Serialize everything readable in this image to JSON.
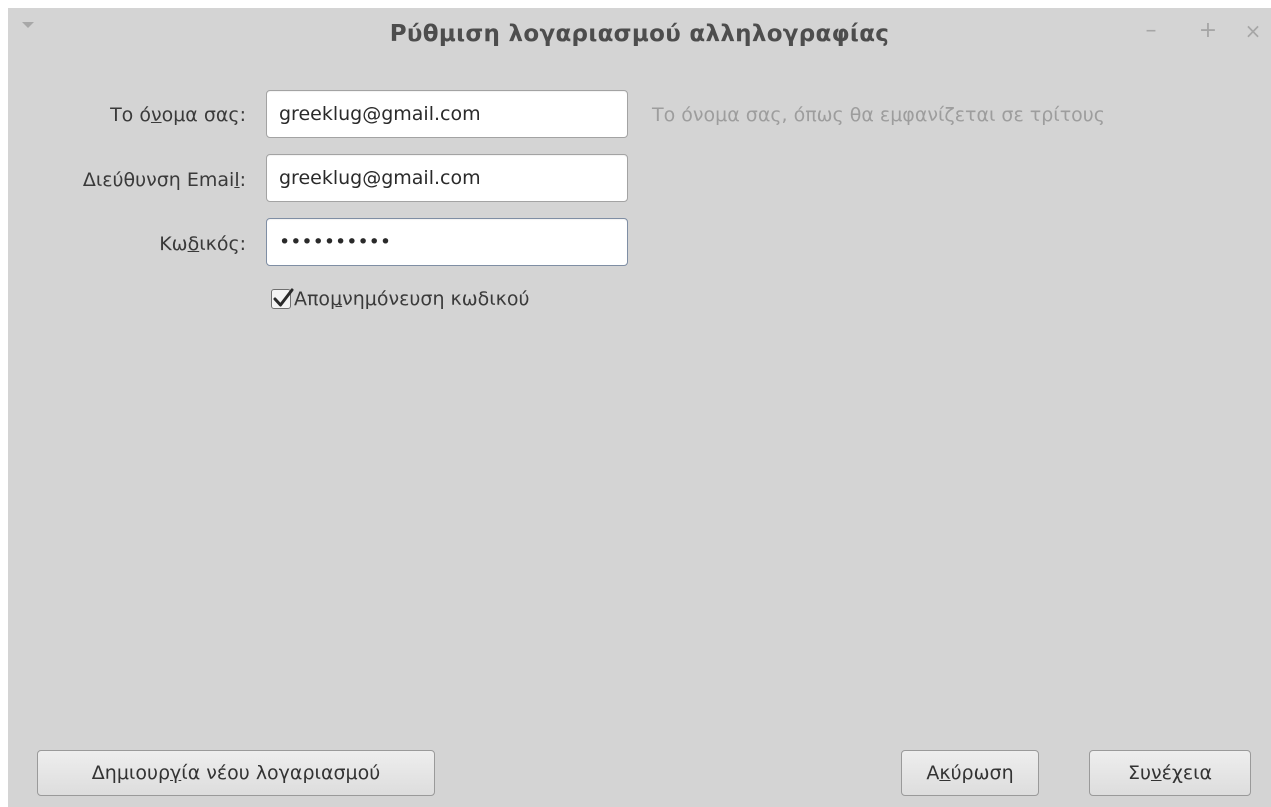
{
  "window": {
    "title": "Ρύθμιση λογαριασμού αλληλογραφίας"
  },
  "titlebar_buttons": {
    "minimize": "–",
    "maximize": "+",
    "close": "×"
  },
  "form": {
    "name": {
      "label_pre": "Το ό",
      "label_key": "ν",
      "label_post": "ομα σας:",
      "value": "greeklug@gmail.com",
      "hint": "Το όνομα σας, όπως θα εμφανίζεται σε τρίτους"
    },
    "email": {
      "label_pre": "Διεύθυνση Emai",
      "label_key": "l",
      "label_post": ":",
      "value": "greeklug@gmail.com"
    },
    "password": {
      "label_pre": "Κω",
      "label_key": "δ",
      "label_post": "ικός:",
      "value": "••••••••••"
    },
    "remember": {
      "checked": true,
      "label_pre": "Απο",
      "label_key": "μ",
      "label_post": "νημόνευση κωδικού"
    }
  },
  "buttons": {
    "create_pre": "Δημιουρ",
    "create_key": "γ",
    "create_post": "ία νέου λογαριασμού",
    "cancel_pre": "Α",
    "cancel_key": "κ",
    "cancel_post": "ύρωση",
    "next_pre": "Συ",
    "next_key": "ν",
    "next_post": "έχεια"
  }
}
